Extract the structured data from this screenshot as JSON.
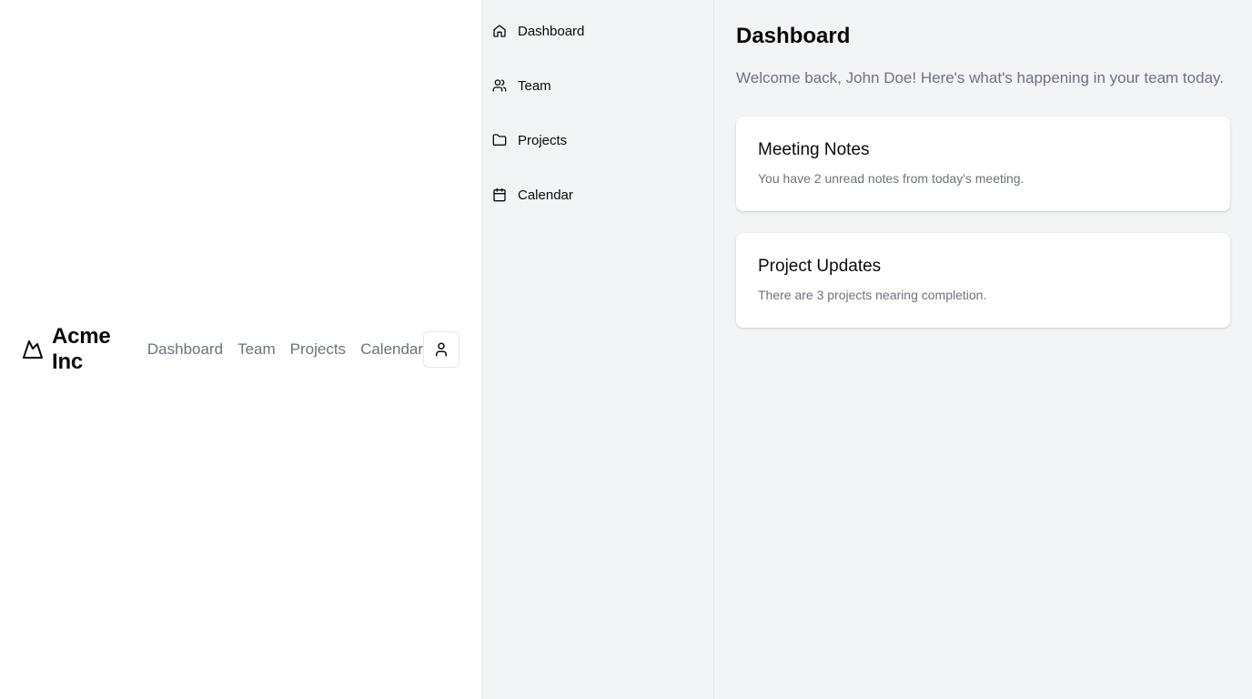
{
  "header": {
    "brand_name": "Acme Inc",
    "brand_icon": "mountain-icon",
    "nav": [
      "Dashboard",
      "Team",
      "Projects",
      "Calendar"
    ],
    "user_icon": "user-icon"
  },
  "sidebar": {
    "items": [
      {
        "label": "Dashboard",
        "icon": "home-icon"
      },
      {
        "label": "Team",
        "icon": "users-icon"
      },
      {
        "label": "Projects",
        "icon": "folder-icon"
      },
      {
        "label": "Calendar",
        "icon": "calendar-icon"
      }
    ]
  },
  "main": {
    "title": "Dashboard",
    "welcome": "Welcome back, John Doe! Here's what's happening in your team today.",
    "cards": [
      {
        "title": "Meeting Notes",
        "text": "You have 2 unread notes from today's meeting."
      },
      {
        "title": "Project Updates",
        "text": "There are 3 projects nearing completion."
      }
    ]
  },
  "colors": {
    "background": "#ffffff",
    "panel": "#f3f4f6",
    "border": "#e5e7eb",
    "muted_text": "#6b7280",
    "text": "#0a0a0a"
  }
}
